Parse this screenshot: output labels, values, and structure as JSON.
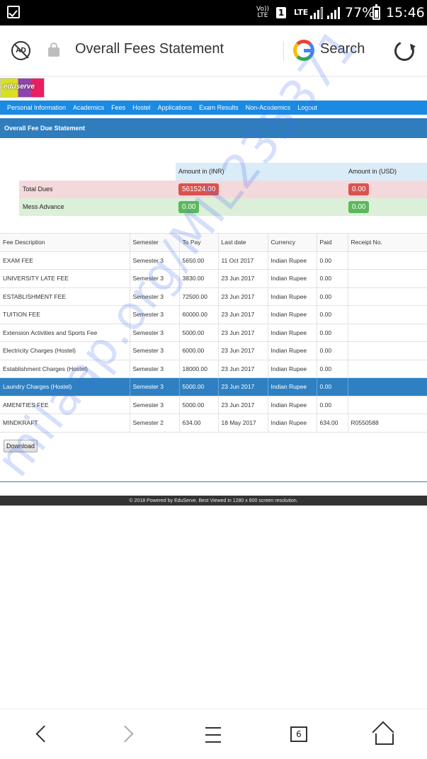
{
  "status_bar": {
    "volte_label": "Vo))\nLTE",
    "sim_slot": "1",
    "network": "LTE",
    "battery": "77%",
    "time": "15:46"
  },
  "browser": {
    "page_title": "Overall Fees Statement",
    "search_label": "Search",
    "tab_count": "6"
  },
  "site": {
    "logo_text": "eduserve",
    "nav_items": [
      "Personal Information",
      "Academics",
      "Fees",
      "Hostel",
      "Applications",
      "Exam Results",
      "Non-Academics",
      "Logout"
    ],
    "section_title": "Overall Fee Due Statement"
  },
  "summary": {
    "col_inr": "Amount in (INR)",
    "col_usd": "Amount in (USD)",
    "total_dues_label": "Total Dues",
    "total_dues_inr": "561524.00",
    "total_dues_usd": "0.00",
    "mess_label": "Mess Advance",
    "mess_inr": "0.00",
    "mess_usd": "0.00"
  },
  "fee_table": {
    "headers": [
      "Fee Description",
      "Semester",
      "To Pay",
      "Last date",
      "Currency",
      "Paid",
      "Receipt No."
    ],
    "rows": [
      [
        "EXAM FEE",
        "Semester 3",
        "5650.00",
        "11 Oct 2017",
        "Indian Rupee",
        "0.00",
        ""
      ],
      [
        "UNIVERSITY LATE FEE",
        "Semester 3",
        "3830.00",
        "23 Jun 2017",
        "Indian Rupee",
        "0.00",
        ""
      ],
      [
        "ESTABLISHMENT FEE",
        "Semester 3",
        "72500.00",
        "23 Jun 2017",
        "Indian Rupee",
        "0.00",
        ""
      ],
      [
        "TUITION FEE",
        "Semester 3",
        "60000.00",
        "23 Jun 2017",
        "Indian Rupee",
        "0.00",
        ""
      ],
      [
        "Extension Activities and Sports Fee",
        "Semester 3",
        "5000.00",
        "23 Jun 2017",
        "Indian Rupee",
        "0.00",
        ""
      ],
      [
        "Electricity Charges (Hostel)",
        "Semester 3",
        "6000.00",
        "23 Jun 2017",
        "Indian Rupee",
        "0.00",
        ""
      ],
      [
        "Establishment Charges (Hostel)",
        "Semester 3",
        "18000.00",
        "23 Jun 2017",
        "Indian Rupee",
        "0.00",
        ""
      ],
      [
        "Laundry Charges (Hostel)",
        "Semester 3",
        "5000.00",
        "23 Jun 2017",
        "Indian Rupee",
        "0.00",
        ""
      ],
      [
        "AMENITIES FEE",
        "Semester 3",
        "5000.00",
        "23 Jun 2017",
        "Indian Rupee",
        "0.00",
        ""
      ],
      [
        "MINDKRAFT",
        "Semester 2",
        "634.00",
        "18 May 2017",
        "Indian Rupee",
        "634.00",
        "R0550588"
      ]
    ],
    "selected_row": 7
  },
  "download_label": "Download",
  "footer_text": "© 2018 Powered by EduServe. Best Viewed in 1280 x 800 screen resolution.",
  "watermark_text": "milaap.org/MIL235371",
  "colors": {
    "nav_blue": "#1a8ae3",
    "section_blue": "#2f7dbd",
    "selected_row": "#2e80c2",
    "due_red": "#d9534f",
    "ok_green": "#5cb85c"
  }
}
